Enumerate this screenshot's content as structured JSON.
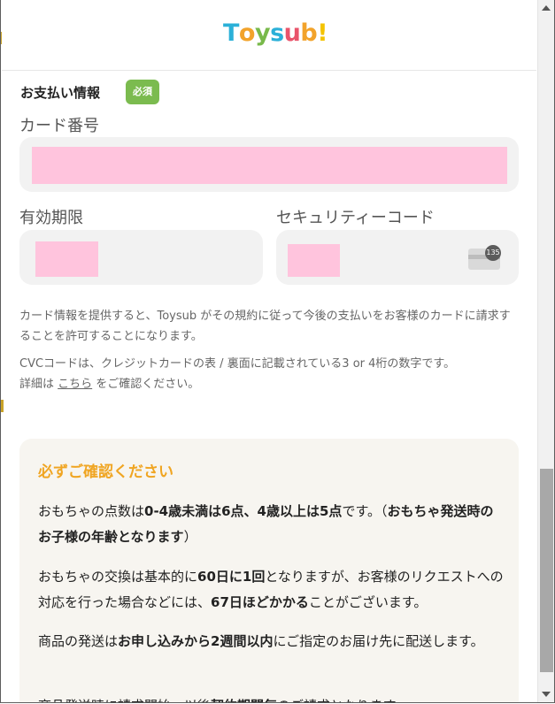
{
  "header": {
    "logo_text": [
      "T",
      "o",
      "y",
      "s",
      "u",
      "b",
      "!"
    ],
    "logo_colors": [
      "#2bb0d8",
      "#f2a32b",
      "#78b94a",
      "#2bb0d8",
      "#e9546b",
      "#f2a32b",
      "#f4c300"
    ]
  },
  "payment": {
    "title": "お支払い情報",
    "required_badge": "必須",
    "card_number_label": "カード番号",
    "expiry_label": "有効期限",
    "security_label": "セキュリティーコード",
    "cvc_icon_number": "135"
  },
  "notes": {
    "authorize": "カード情報を提供すると、Toysub がその規約に従って今後の支払いをお客様のカードに請求することを許可することになります。",
    "cvc_line1": "CVCコードは、クレジットカードの表 / 裏面に記載されている3 or 4桁の数字です。",
    "detail_prefix": "詳細は ",
    "detail_link": "こちら",
    "detail_suffix": " をご確認ください。"
  },
  "confirm": {
    "title": "必ずご確認ください",
    "p1": [
      {
        "t": "おもちゃの点数は",
        "b": false
      },
      {
        "t": "0-4歳未満は6点、4歳以上は5点",
        "b": true
      },
      {
        "t": "です。（",
        "b": false
      },
      {
        "t": "おもちゃ発送時のお子様の年齢となります",
        "b": true
      },
      {
        "t": "）",
        "b": false
      }
    ],
    "p2": [
      {
        "t": "おもちゃの交換は基本的に",
        "b": false
      },
      {
        "t": "60日に1回",
        "b": true
      },
      {
        "t": "となりますが、お客様のリクエストへの対応を行った場合などには、",
        "b": false
      },
      {
        "t": "67日ほどかかる",
        "b": true
      },
      {
        "t": "ことがございます。",
        "b": false
      }
    ],
    "p3": [
      {
        "t": "商品の発送は",
        "b": false
      },
      {
        "t": "お申し込みから2週間以内",
        "b": true
      },
      {
        "t": "にご指定のお届け先に配送します。",
        "b": false
      }
    ],
    "p4": [
      {
        "t": "商品発送時に請求開始。以後",
        "b": false
      },
      {
        "t": "契約期間毎",
        "b": true
      },
      {
        "t": "のご請求となります。",
        "b": false
      }
    ]
  }
}
